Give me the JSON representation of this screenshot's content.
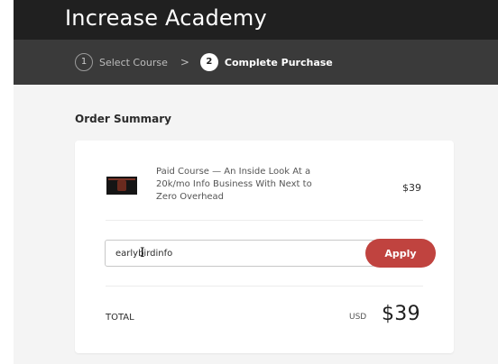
{
  "header": {
    "brand": "Increase Academy"
  },
  "steps": [
    {
      "number": "1",
      "label": "Select Course"
    },
    {
      "number": "2",
      "label": "Complete Purchase"
    }
  ],
  "step_separator": ">",
  "order_summary": {
    "title": "Order Summary",
    "product": {
      "name": "Paid Course — An Inside Look At a 20k/mo Info Business With Next to Zero Overhead",
      "price": "$39"
    },
    "coupon": {
      "value": "earlybirdinfo",
      "apply_label": "Apply"
    },
    "total": {
      "label": "TOTAL",
      "currency": "USD",
      "amount": "$39"
    }
  },
  "colors": {
    "header_bg": "#202020",
    "steps_bg": "#3a3a3a",
    "page_bg": "#f4f4f4",
    "accent": "#c0433f"
  }
}
